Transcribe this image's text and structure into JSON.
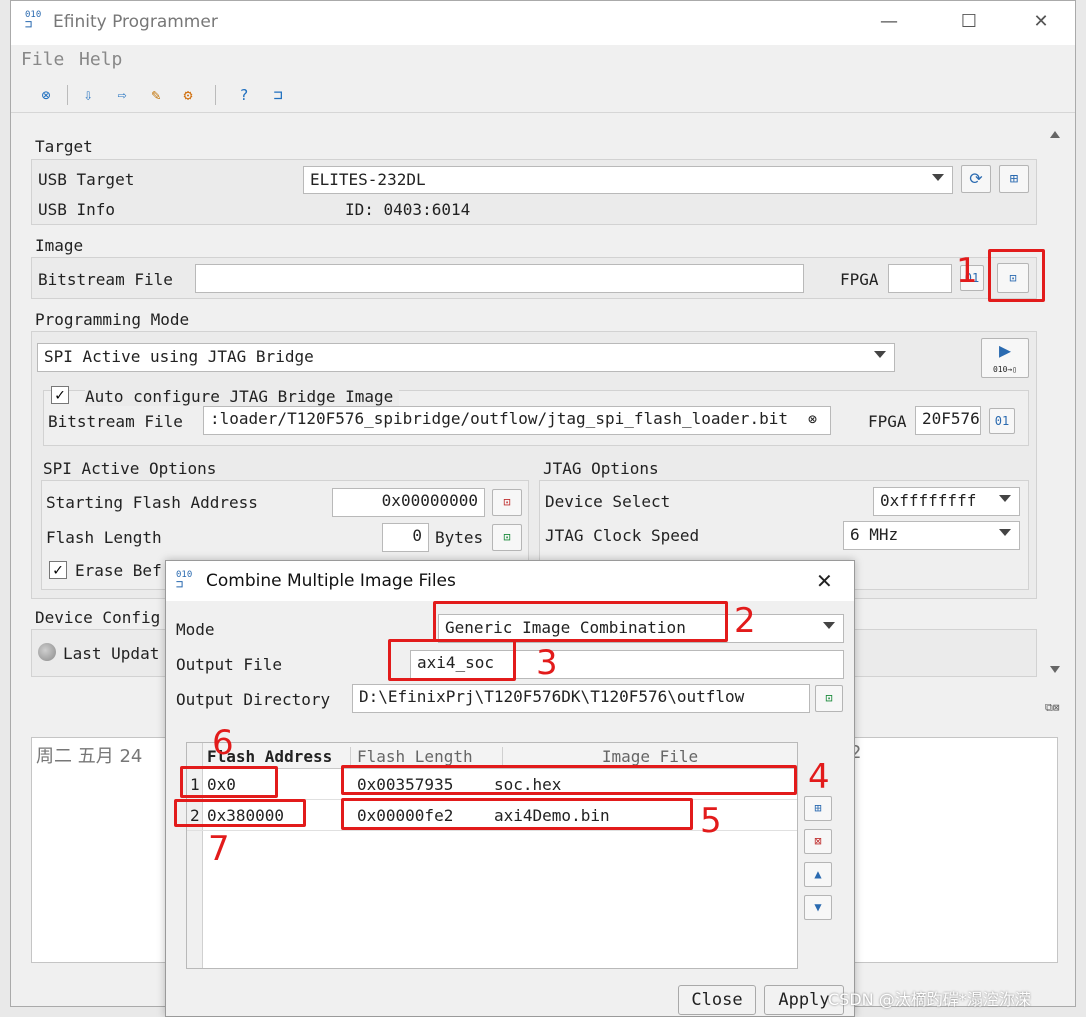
{
  "window": {
    "title": "Efinity Programmer",
    "app_icon_text": "010",
    "minimize": "—",
    "maximize": "☐",
    "close": "✕"
  },
  "menu": {
    "file": "File",
    "help": "Help"
  },
  "target": {
    "section_title": "Target",
    "usb_target_label": "USB Target",
    "usb_target_value": "ELITES-232DL",
    "usb_info_label": "USB Info",
    "usb_info_value": "ID: 0403:6014"
  },
  "image": {
    "section_title": "Image",
    "bitstream_label": "Bitstream File",
    "bitstream_value": "",
    "fpga_label": "FPGA",
    "fpga_value": ""
  },
  "programming_mode": {
    "section_title": "Programming Mode",
    "mode_value": "SPI Active using JTAG Bridge",
    "auto_configure_label": "Auto configure JTAG Bridge Image",
    "auto_configure_checked": true,
    "bridge_bitstream_label": "Bitstream File",
    "bridge_bitstream_value": ":loader/T120F576_spibridge/outflow/jtag_spi_flash_loader.bit",
    "bridge_fpga_label": "FPGA",
    "bridge_fpga_value": "20F576"
  },
  "spi_options": {
    "section_title": "SPI Active Options",
    "start_addr_label": "Starting Flash Address",
    "start_addr_value": "0x00000000",
    "flash_length_label": "Flash Length",
    "flash_length_value": "0",
    "bytes_label": "Bytes",
    "erase_label": "Erase Bef"
  },
  "jtag_options": {
    "section_title": "JTAG Options",
    "device_select_label": "Device Select",
    "device_select_value": "0xffffffff",
    "clock_speed_label": "JTAG Clock Speed",
    "clock_speed_value": "6 MHz"
  },
  "device_config": {
    "section_title": "Device Config",
    "last_update_label": "Last Updat"
  },
  "log": {
    "visible_text": "周二 五月 24",
    "tail_char": "2"
  },
  "dialog": {
    "title": "Combine Multiple Image Files",
    "mode_label": "Mode",
    "mode_value": "Generic Image Combination",
    "output_file_label": "Output File",
    "output_file_value": "axi4_soc",
    "output_dir_label": "Output Directory",
    "output_dir_value": "D:\\EfinixPrj\\T120F576DK\\T120F576\\outflow",
    "columns": [
      "Flash Address",
      "Flash Length",
      "Image File"
    ],
    "rows": [
      {
        "index": "1",
        "address": "0x0",
        "length": "0x00357935",
        "file": "soc.hex"
      },
      {
        "index": "2",
        "address": "0x380000",
        "length": "0x00000fe2",
        "file": "axi4Demo.bin"
      }
    ],
    "close_button": "Close",
    "apply_button": "Apply"
  },
  "annotations": [
    "1",
    "2",
    "3",
    "4",
    "5",
    "6",
    "7"
  ],
  "watermark": "CSDN @汰樀趵硸*溻涳沵溁",
  "colors": {
    "annotation_red": "#e21b1b",
    "icon_blue": "#1f6fbf"
  }
}
